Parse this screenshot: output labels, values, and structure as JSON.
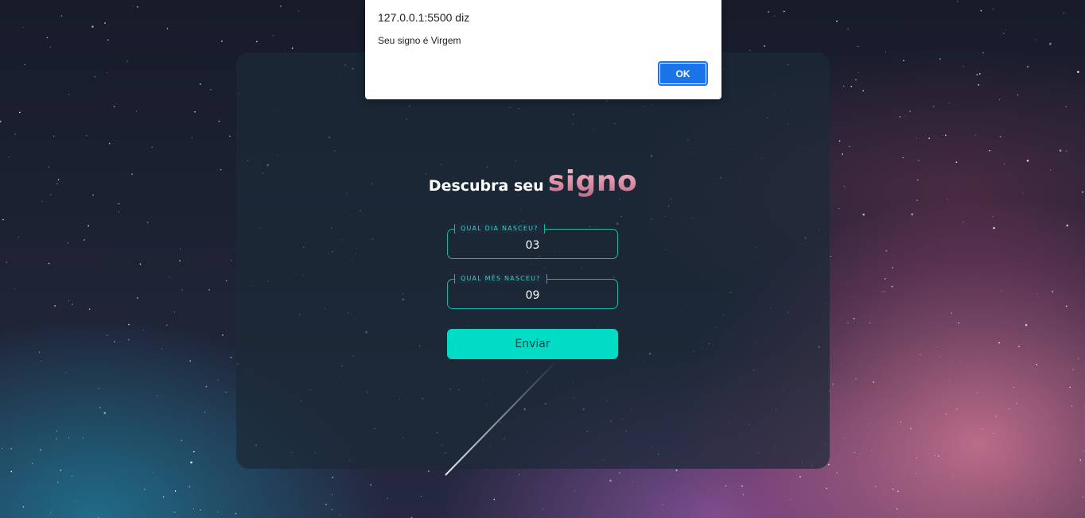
{
  "form": {
    "title_main": "Descubra seu",
    "title_accent": "signo",
    "day_label": "QUAL DIA NASCEU?",
    "day_value": "03",
    "month_label": "QUAL MÊS NASCEU?",
    "month_value": "09",
    "submit_label": "Enviar"
  },
  "alert": {
    "origin": "127.0.0.1:5500 diz",
    "message": "Seu signo é Virgem",
    "ok_label": "OK"
  },
  "colors": {
    "accent_teal": "#00dcc5",
    "title_pink": "#e0a3b4",
    "dialog_button": "#1a73e8"
  }
}
